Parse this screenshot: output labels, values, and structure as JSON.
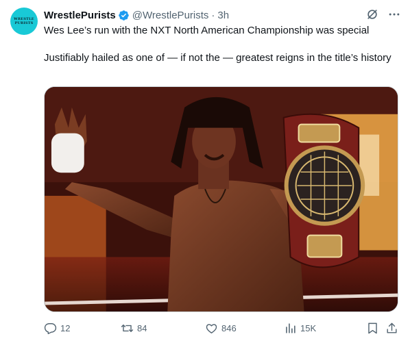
{
  "author": {
    "avatar_line1": "WRESTLE",
    "avatar_line2": "PURISTS",
    "name": "WrestlePurists",
    "handle": "@WrestlePurists",
    "separator": "·",
    "time": "3h"
  },
  "tweet": {
    "line1": "Wes Lee’s run with the NXT North American Championship was special",
    "line2": "Justifiably hailed as one of — if not the — greatest reigns in the title’s history"
  },
  "actions": {
    "replies": "12",
    "reposts": "84",
    "likes": "846",
    "views": "15K"
  },
  "colors": {
    "text": "#0f1419",
    "secondary": "#536471",
    "verified": "#1d9bf0",
    "avatar_bg": "#19c9d6",
    "border": "#cfd9de"
  },
  "icons": [
    "verified-badge-icon",
    "grok-icon",
    "more-icon",
    "reply-icon",
    "repost-icon",
    "like-icon",
    "views-icon",
    "bookmark-icon",
    "share-icon"
  ]
}
